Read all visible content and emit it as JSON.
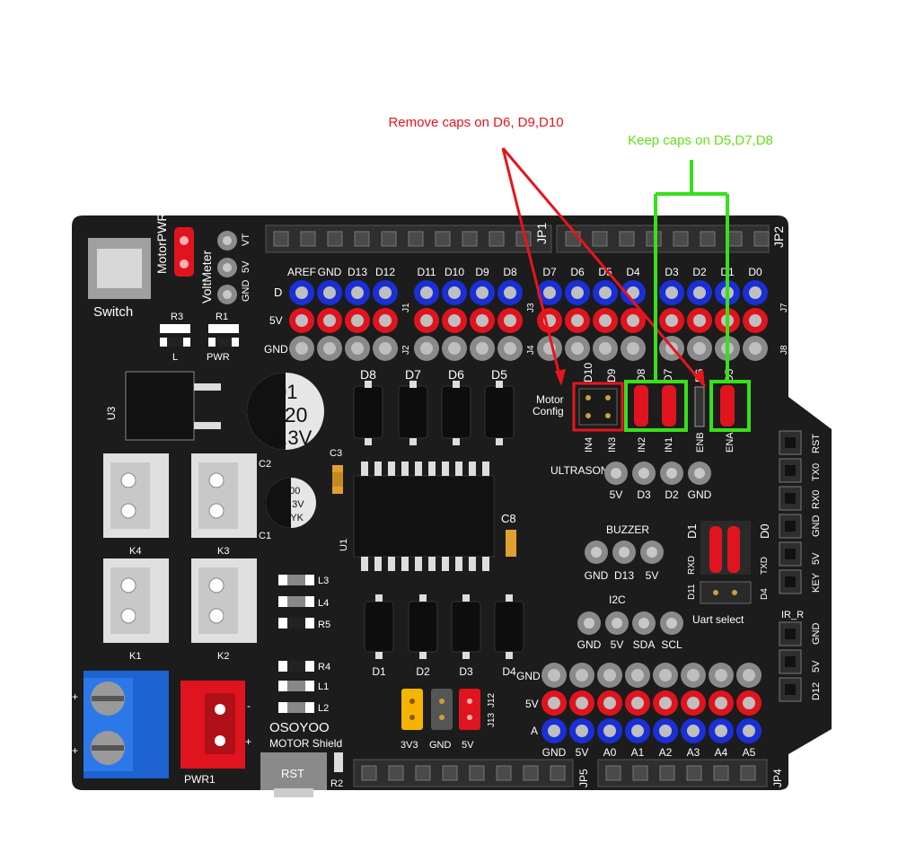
{
  "annotations": {
    "remove": "Remove caps on D6, D9,D10",
    "keep": "Keep caps on D5,D7,D8"
  },
  "board": {
    "brand": "OSOYOO",
    "model": "MOTOR Shield",
    "switch_label": "Switch",
    "motor_pwr": "MotorPWR",
    "volt_meter": "VoltMeter",
    "vt_pins": [
      "VT",
      "5V",
      "GND"
    ],
    "r3": "R3",
    "r1": "R1",
    "l_label": "L",
    "pwr_label": "PWR",
    "u3": "U3",
    "u1": "U1",
    "cap_big": [
      "01",
      "220",
      "6.3V"
    ],
    "cap_small": [
      "100",
      "6.3V",
      "SYK"
    ],
    "c1": "C1",
    "c2": "C2",
    "c3": "C3",
    "c8": "C8",
    "connectors": [
      "K4",
      "K3",
      "K1",
      "K2"
    ],
    "top_headers": [
      "AREF",
      "GND",
      "D13",
      "D12",
      "D11",
      "D10",
      "D9",
      "D8",
      "D7",
      "D6",
      "D5",
      "D4",
      "D3",
      "D2",
      "D1",
      "D0"
    ],
    "row_labels": [
      "D",
      "5V",
      "GND"
    ],
    "jp1": "JP1",
    "jp2": "JP2",
    "j_labels": [
      "J1",
      "J2",
      "J3",
      "J4",
      "J5",
      "J6",
      "J7",
      "J8"
    ],
    "mosfets_top": [
      "D8",
      "D7",
      "D6",
      "D5"
    ],
    "diodes": [
      "D1",
      "D2",
      "D3",
      "D4"
    ],
    "resistors": [
      "L3",
      "L4",
      "R5",
      "R4",
      "L1",
      "L2"
    ],
    "motor_config": [
      "Motor",
      "Config"
    ],
    "config_top": [
      "D10",
      "D9",
      "D8",
      "D7",
      "D6",
      "D5"
    ],
    "config_bottom": [
      "IN4",
      "IN3",
      "IN2",
      "IN1",
      "ENB",
      "ENA"
    ],
    "ultrasonic": "ULTRASONIC",
    "ultrasonic_pins": [
      "5V",
      "D3",
      "D2",
      "GND"
    ],
    "buzzer": "BUZZER",
    "buzzer_pins": [
      "GND",
      "D13",
      "5V"
    ],
    "i2c": "I2C",
    "i2c_pins": [
      "GND",
      "5V",
      "SDA",
      "SCL"
    ],
    "uart": "Uart select",
    "uart_labels": [
      "D1",
      "D0",
      "RXD",
      "TXD",
      "D11",
      "D4"
    ],
    "serial_pins": [
      "RST",
      "TX0",
      "RX0",
      "GND",
      "5V",
      "KEY"
    ],
    "irr": "IR_R",
    "irr_pins": [
      "GND",
      "5V",
      "D12"
    ],
    "bottom_rows": [
      "GND",
      "5V",
      "A"
    ],
    "analog_pins": [
      "GND",
      "5V",
      "A0",
      "A1",
      "A2",
      "A3",
      "A4",
      "A5"
    ],
    "jumpers": [
      "3V3",
      "GND",
      "5V"
    ],
    "j12": "J12",
    "j13": "J13",
    "jp4": "JP4",
    "jp5": "JP5",
    "pwr1": "PWR1",
    "rst": "RST",
    "r2": "R2",
    "plus": "+",
    "minus": "-"
  },
  "colors": {
    "board": "#1c1c1c",
    "pin_blue": "#1a2fd6",
    "pin_red": "#e0141e",
    "pin_grey": "#8a8a8a",
    "highlight_red": "#e8141c",
    "highlight_green": "#38e01a",
    "jumper_yellow": "#f5b400"
  }
}
